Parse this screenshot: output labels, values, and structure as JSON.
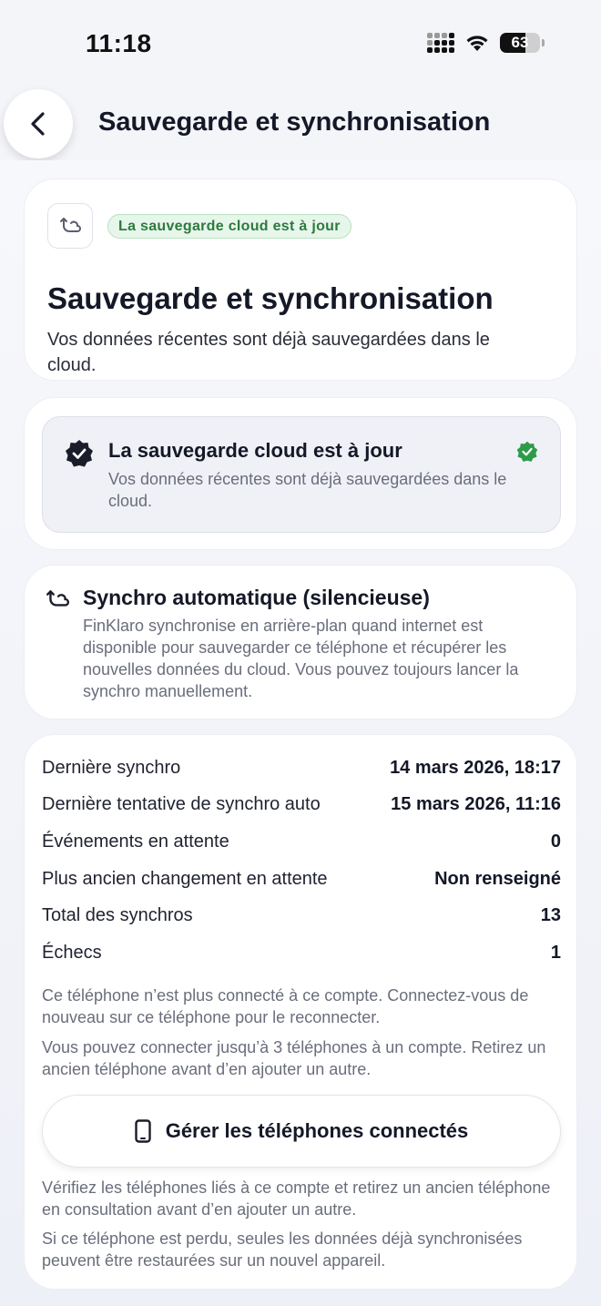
{
  "status_bar": {
    "time": "11:18",
    "battery": "63"
  },
  "header": {
    "title": "Sauvegarde et synchronisation"
  },
  "hero": {
    "badge": "La sauvegarde cloud est à jour",
    "title": "Sauvegarde et synchronisation",
    "description": "Vos données récentes sont déjà sauvegardées dans le cloud."
  },
  "status": {
    "title": "La sauvegarde cloud est à jour",
    "description": "Vos données récentes sont déjà sauvegardées dans le cloud."
  },
  "auto_sync": {
    "title": "Synchro automatique (silencieuse)",
    "description": "FinKlaro synchronise en arrière-plan quand internet est disponible pour sauvegarder ce téléphone et récupérer les nouvelles données du cloud. Vous pouvez toujours lancer la synchro manuellement."
  },
  "details": {
    "rows": [
      {
        "label": "Dernière synchro",
        "value": "14 mars 2026, 18:17"
      },
      {
        "label": "Dernière tentative de synchro auto",
        "value": "15 mars 2026, 11:16"
      },
      {
        "label": "Événements en attente",
        "value": "0"
      },
      {
        "label": "Plus ancien changement en attente",
        "value": "Non renseigné"
      },
      {
        "label": "Total des synchros",
        "value": "13"
      },
      {
        "label": "Échecs",
        "value": "1"
      }
    ],
    "note_disconnected": "Ce téléphone n’est plus connecté à ce compte. Connectez-vous de nouveau sur ce téléphone pour le reconnecter.",
    "note_limit": "Vous pouvez connecter jusqu’à 3 téléphones à un compte. Retirez un ancien téléphone avant d’en ajouter un autre.",
    "manage_button": "Gérer les téléphones connectés",
    "note_verify": "Vérifiez les téléphones liés à ce compte et retirez un ancien téléphone en consultation avant d’en ajouter un autre.",
    "note_lost": "Si ce téléphone est perdu, seules les données déjà synchronisées peuvent être restaurées sur un nouvel appareil."
  },
  "colors": {
    "success": "#2d9b4a",
    "badge_bg": "#e7f6ea",
    "text_primary": "#141827",
    "text_secondary": "#6a6e7c"
  },
  "icons": {
    "back": "chevron-left-icon",
    "sync": "cloud-sync-icon",
    "verified": "verified-badge-icon",
    "phone": "smartphone-icon"
  }
}
